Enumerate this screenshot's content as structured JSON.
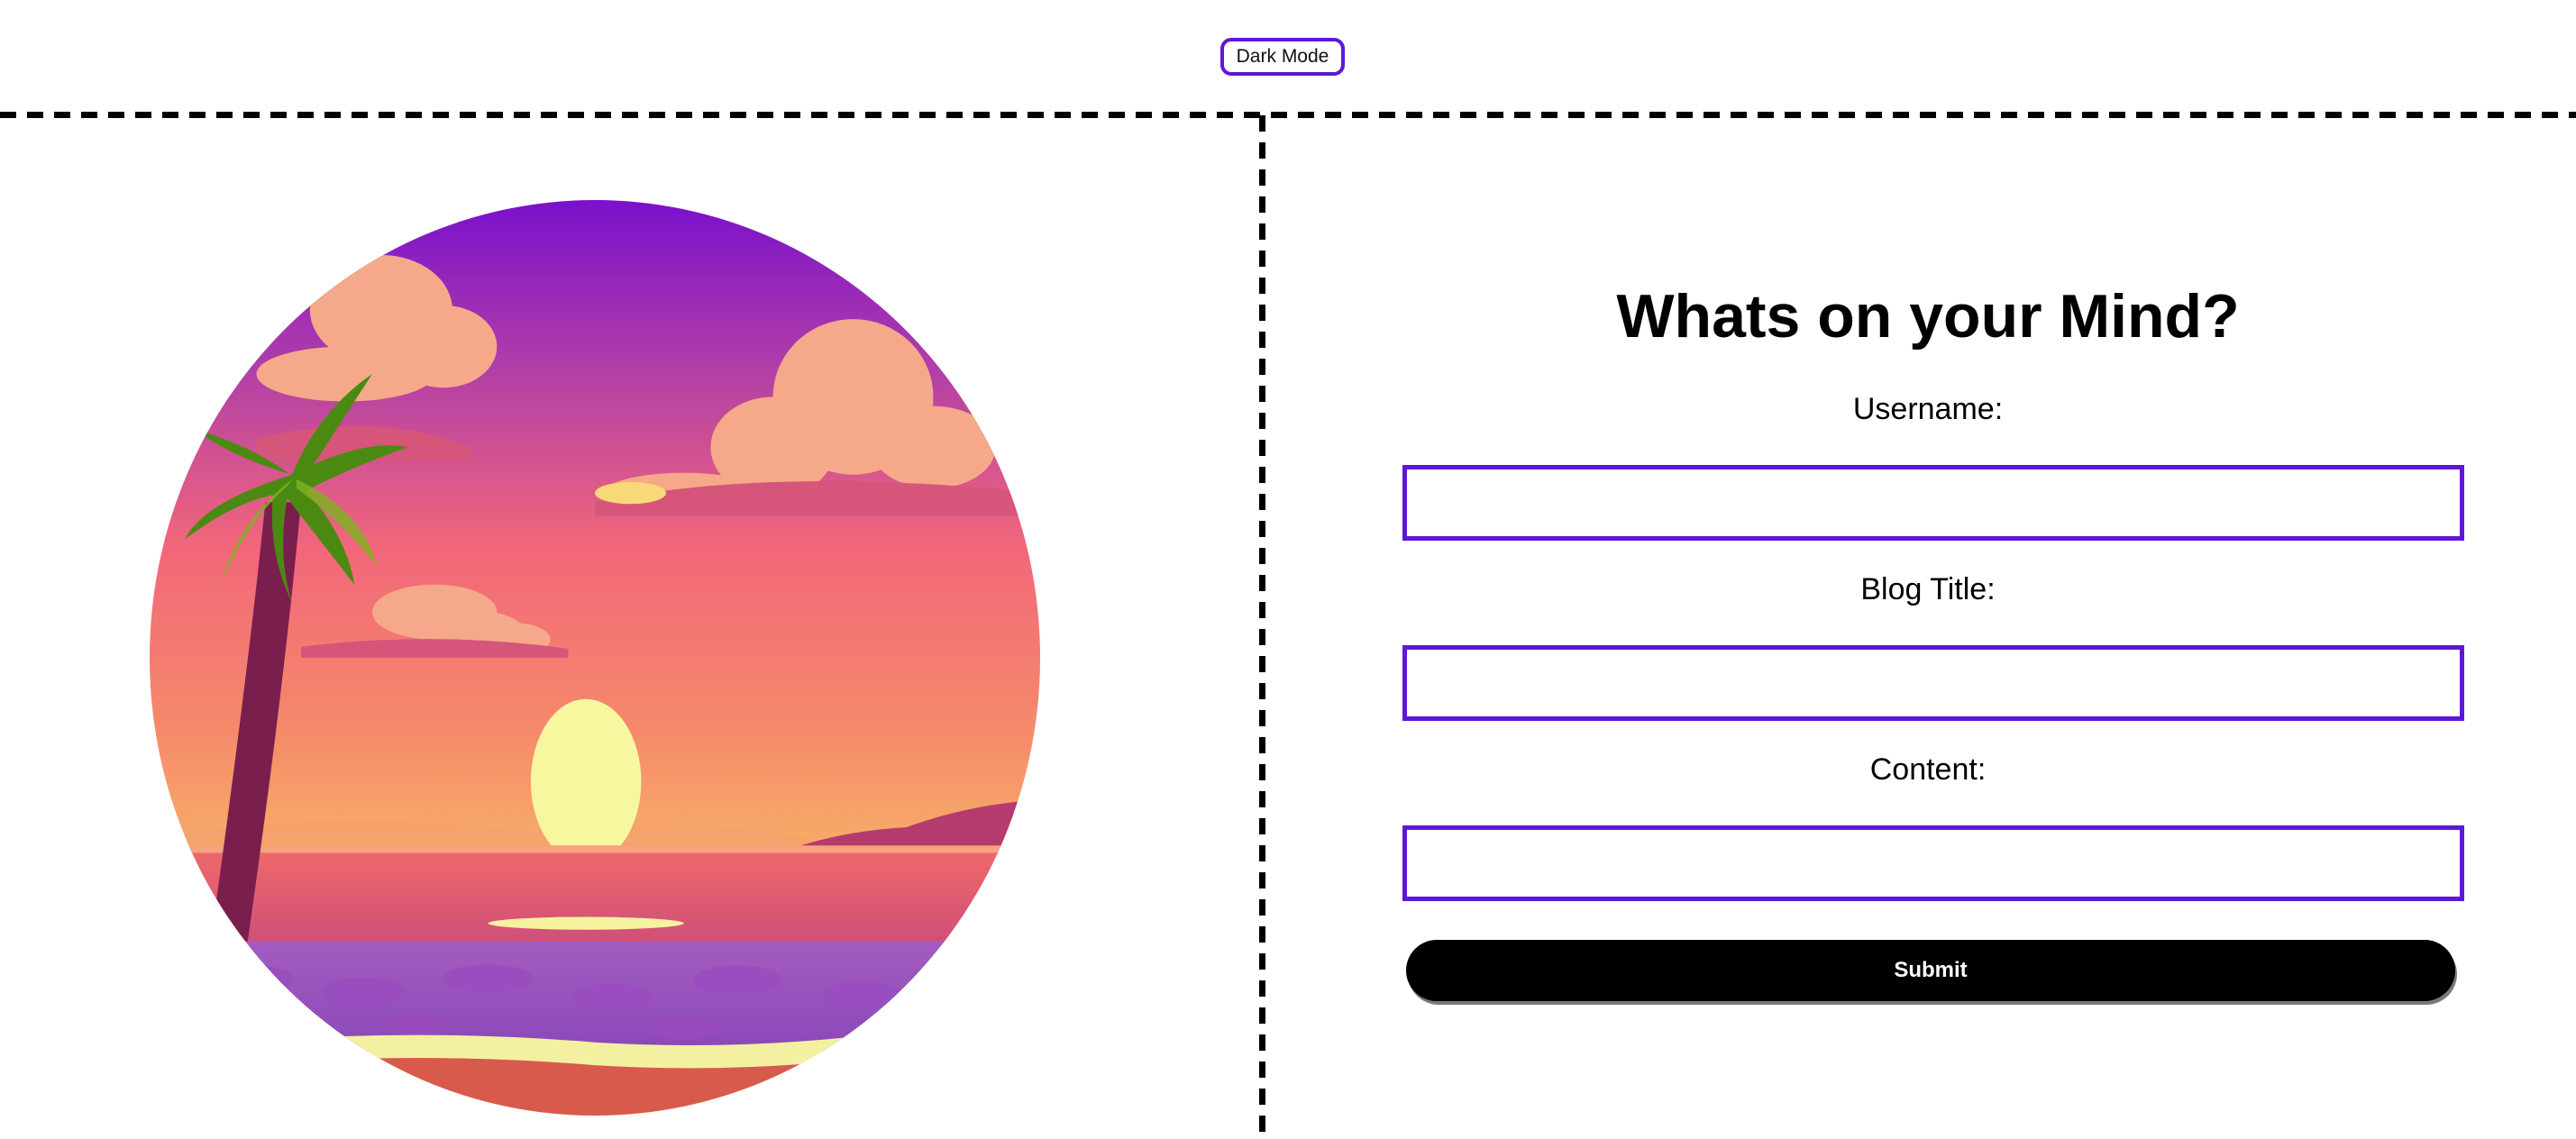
{
  "header": {
    "dark_mode_label": "Dark Mode"
  },
  "hero": {
    "image": "sunset-beach-illustration"
  },
  "form": {
    "title": "Whats on your Mind?",
    "fields": [
      {
        "label": "Username:",
        "value": "",
        "placeholder": ""
      },
      {
        "label": "Blog Title:",
        "value": "",
        "placeholder": ""
      },
      {
        "label": "Content:",
        "value": "",
        "placeholder": ""
      }
    ],
    "submit_label": "Submit"
  },
  "colors": {
    "accent": "#5e17d6",
    "button_bg": "#000000",
    "button_text": "#ffffff"
  }
}
